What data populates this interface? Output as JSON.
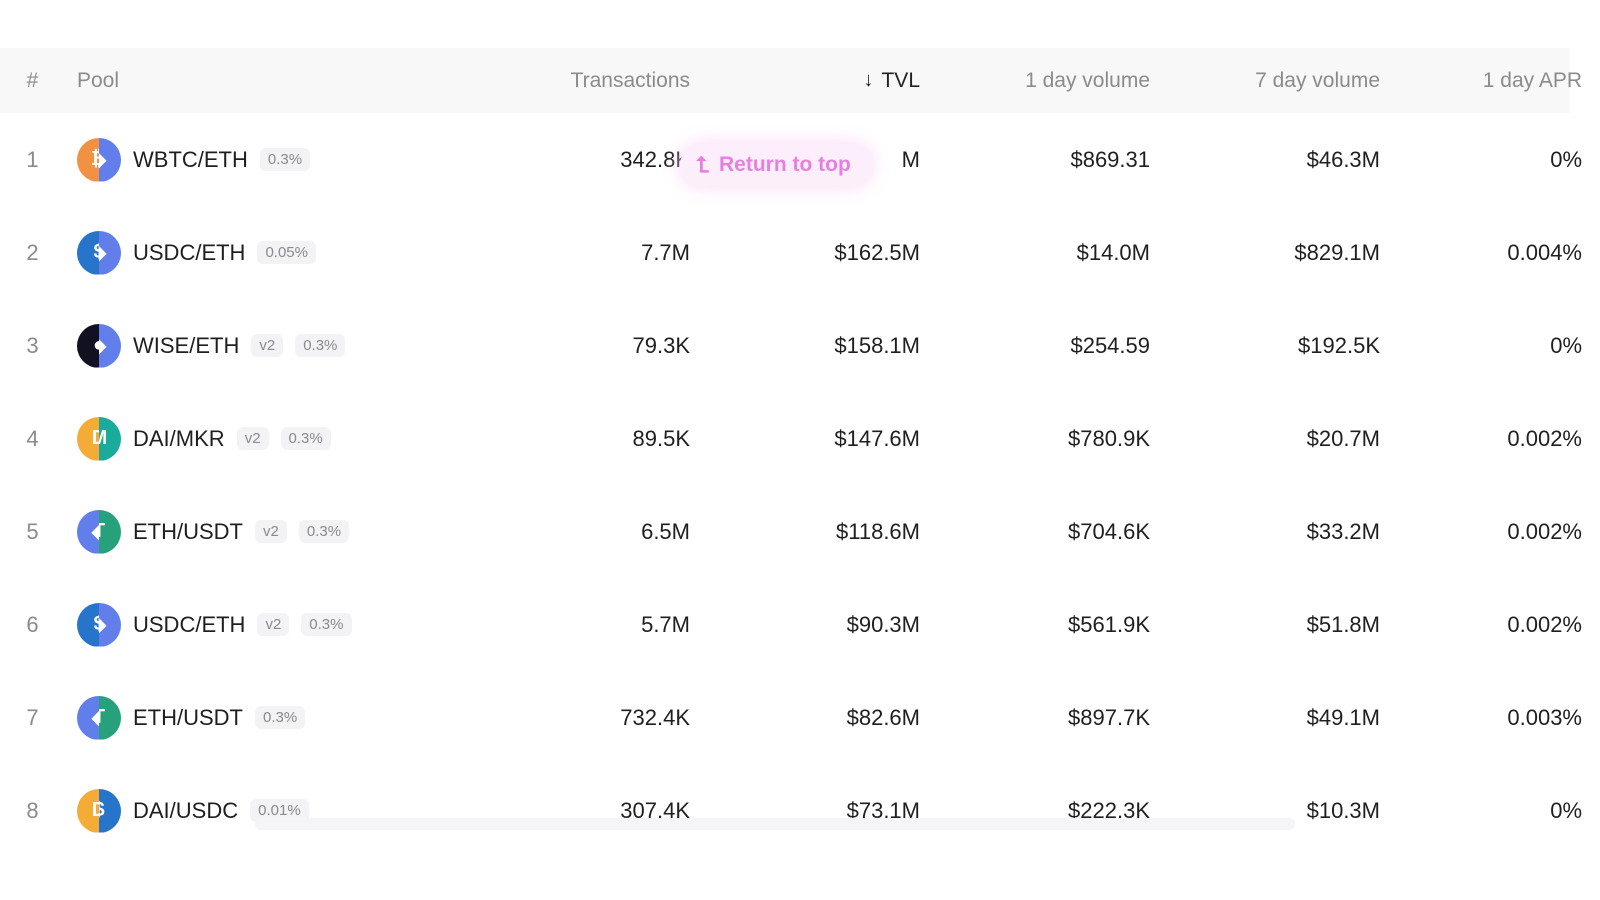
{
  "header": {
    "num": "#",
    "pool": "Pool",
    "transactions": "Transactions",
    "tvl_arrow": "↓",
    "tvl": "TVL",
    "volume_1d": "1 day volume",
    "volume_7d": "7 day volume",
    "apr_1d": "1 day APR"
  },
  "return_to_top": {
    "arrow": "⮤",
    "label": "Return to top"
  },
  "rows": [
    {
      "num": "1",
      "pool": "WBTC/ETH",
      "version": "",
      "fee": "0.3%",
      "transactions": "342.8K",
      "tvl": "M",
      "volume_1d": "$869.31",
      "volume_7d": "$46.3M",
      "apr_1d": "0%",
      "tokens": [
        "wbtc",
        "eth"
      ]
    },
    {
      "num": "2",
      "pool": "USDC/ETH",
      "version": "",
      "fee": "0.05%",
      "transactions": "7.7M",
      "tvl": "$162.5M",
      "volume_1d": "$14.0M",
      "volume_7d": "$829.1M",
      "apr_1d": "0.004%",
      "tokens": [
        "usdc",
        "eth"
      ]
    },
    {
      "num": "3",
      "pool": "WISE/ETH",
      "version": "v2",
      "fee": "0.3%",
      "transactions": "79.3K",
      "tvl": "$158.1M",
      "volume_1d": "$254.59",
      "volume_7d": "$192.5K",
      "apr_1d": "0%",
      "tokens": [
        "wise",
        "eth"
      ]
    },
    {
      "num": "4",
      "pool": "DAI/MKR",
      "version": "v2",
      "fee": "0.3%",
      "transactions": "89.5K",
      "tvl": "$147.6M",
      "volume_1d": "$780.9K",
      "volume_7d": "$20.7M",
      "apr_1d": "0.002%",
      "tokens": [
        "dai",
        "mkr"
      ]
    },
    {
      "num": "5",
      "pool": "ETH/USDT",
      "version": "v2",
      "fee": "0.3%",
      "transactions": "6.5M",
      "tvl": "$118.6M",
      "volume_1d": "$704.6K",
      "volume_7d": "$33.2M",
      "apr_1d": "0.002%",
      "tokens": [
        "eth",
        "usdt"
      ]
    },
    {
      "num": "6",
      "pool": "USDC/ETH",
      "version": "v2",
      "fee": "0.3%",
      "transactions": "5.7M",
      "tvl": "$90.3M",
      "volume_1d": "$561.9K",
      "volume_7d": "$51.8M",
      "apr_1d": "0.002%",
      "tokens": [
        "usdc",
        "eth"
      ]
    },
    {
      "num": "7",
      "pool": "ETH/USDT",
      "version": "",
      "fee": "0.3%",
      "transactions": "732.4K",
      "tvl": "$82.6M",
      "volume_1d": "$897.7K",
      "volume_7d": "$49.1M",
      "apr_1d": "0.003%",
      "tokens": [
        "eth",
        "usdt"
      ]
    },
    {
      "num": "8",
      "pool": "DAI/USDC",
      "version": "",
      "fee": "0.01%",
      "transactions": "307.4K",
      "tvl": "$73.1M",
      "volume_1d": "$222.3K",
      "volume_7d": "$10.3M",
      "apr_1d": "0%",
      "tokens": [
        "dai",
        "usdc"
      ]
    }
  ],
  "token_colors": {
    "wbtc": "#f09242",
    "eth": "#627eea",
    "usdc": "#2775ca",
    "wise": "#111122",
    "dai": "#f5ac37",
    "mkr": "#1aab9b",
    "usdt": "#26a17b"
  },
  "token_glyphs": {
    "wbtc": "₿",
    "eth": "◆",
    "usdc": "$",
    "wise": "◐",
    "dai": "D",
    "mkr": "M",
    "usdt": "T"
  }
}
